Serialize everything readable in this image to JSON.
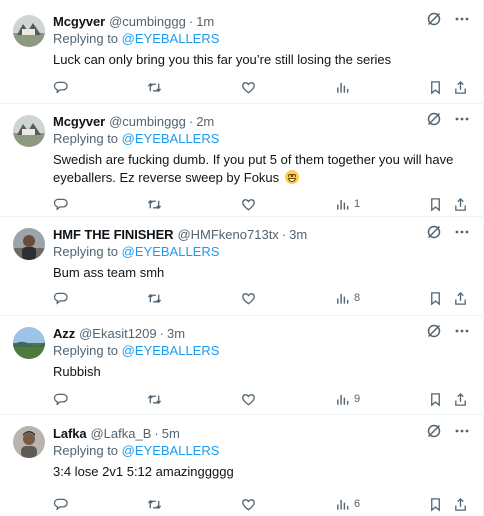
{
  "reply_prefix": "Replying to",
  "more_label": "···",
  "colors": {
    "accent": "#1d9bf0",
    "muted": "#536471",
    "text": "#0f1419",
    "divider": "#eff3f4"
  },
  "icons": {
    "grok": "grok-icon",
    "more": "more-icon",
    "reply": "reply-icon",
    "retweet": "retweet-icon",
    "like": "like-icon",
    "views": "views-icon",
    "bookmark": "bookmark-icon",
    "share": "share-icon"
  },
  "tweets": [
    {
      "name": "Mcgyver",
      "handle": "@cumbinggg",
      "dot": "·",
      "time": "1m",
      "mention": "@EYEBALLERS",
      "text": "Luck can only bring you this far you’re still losing the series",
      "views": ""
    },
    {
      "name": "Mcgyver",
      "handle": "@cumbinggg",
      "dot": "·",
      "time": "2m",
      "mention": "@EYEBALLERS",
      "text": "Swedish are fucking dumb. If you put 5 of them together you will have eyeballers. Ez reverse sweep by Fokus",
      "views": "1"
    },
    {
      "name": "HMF THE FINISHER",
      "handle": "@HMFkeno713tx",
      "dot": "·",
      "time": "3m",
      "mention": "@EYEBALLERS",
      "text": "Bum ass team smh",
      "views": "8"
    },
    {
      "name": "Azz",
      "handle": "@Ekasit1209",
      "dot": "·",
      "time": "3m",
      "mention": "@EYEBALLERS",
      "text": "Rubbish",
      "views": "9"
    },
    {
      "name": "Lafka",
      "handle": "@Lafka_B",
      "dot": "·",
      "time": "5m",
      "mention": "@EYEBALLERS",
      "text": "3:4 lose 2v1 5:12 amazinggggg",
      "views": "6"
    }
  ]
}
